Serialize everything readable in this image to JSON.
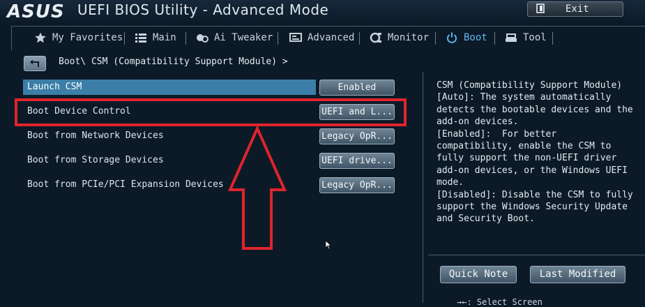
{
  "header": {
    "logo": "ASUS",
    "title": "UEFI BIOS Utility - Advanced Mode",
    "exit_label": "Exit"
  },
  "tabs": [
    {
      "label": "My Favorites",
      "icon": "star-icon",
      "active": false
    },
    {
      "label": "Main",
      "icon": "list-icon",
      "active": false
    },
    {
      "label": "Ai Tweaker",
      "icon": "tweaker-icon",
      "active": false
    },
    {
      "label": "Advanced",
      "icon": "advanced-icon",
      "active": false
    },
    {
      "label": "Monitor",
      "icon": "monitor-icon",
      "active": false
    },
    {
      "label": "Boot",
      "icon": "power-icon",
      "active": true
    },
    {
      "label": "Tool",
      "icon": "tool-icon",
      "active": false
    }
  ],
  "breadcrumb": "Boot\\ CSM (Compatibility Support Module) >",
  "settings": [
    {
      "label": "Launch CSM",
      "value": "Enabled"
    },
    {
      "label": "Boot Device Control",
      "value": "UEFI and L..."
    },
    {
      "label": "Boot from Network Devices",
      "value": "Legacy OpR..."
    },
    {
      "label": "Boot from Storage Devices",
      "value": "UEFI drive..."
    },
    {
      "label": "Boot from PCIe/PCI Expansion Devices",
      "value": "Legacy OpR..."
    }
  ],
  "help": {
    "text": "CSM (Compatibility Support Module)\n[Auto]: The system automatically\ndetects the bootable devices and the\nadd-on devices.\n[Enabled]:  For better\ncompatibility, enable the CSM to\nfully support the non-UEFI driver\nadd-on devices, or the Windows UEFI\nmode.\n[Disabled]: Disable the CSM to fully\nsupport the Windows Security Update\nand Security Boot."
  },
  "panel_buttons": {
    "quick_note": "Quick Note",
    "last_modified": "Last Modified"
  },
  "footer_cut": "→←: Select Screen",
  "colors": {
    "background": "#0c1a27",
    "selected_row": "#3b7fa8",
    "active_tab": "#5fb4ef",
    "annotation": "#e0242c"
  }
}
